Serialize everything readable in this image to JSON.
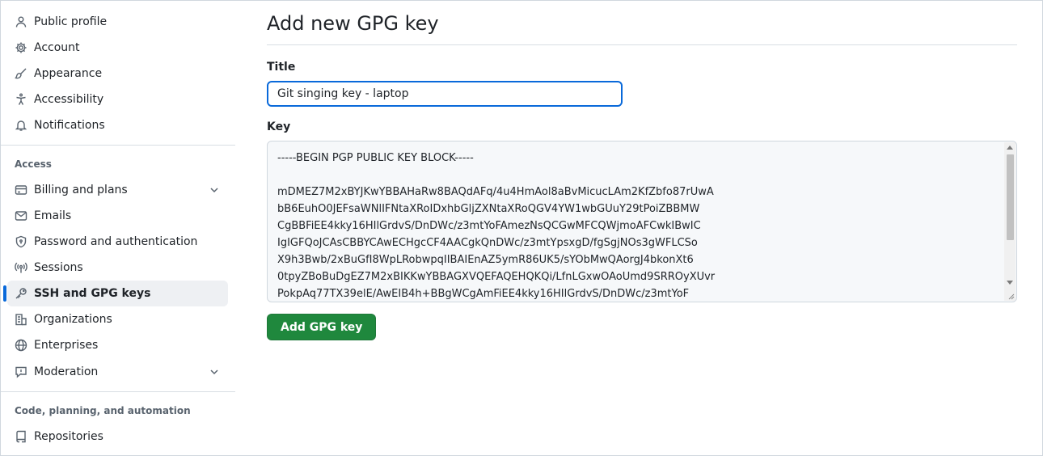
{
  "sidebar": {
    "items_top": [
      {
        "label": "Public profile",
        "icon": "person-icon"
      },
      {
        "label": "Account",
        "icon": "gear-icon"
      },
      {
        "label": "Appearance",
        "icon": "paintbrush-icon"
      },
      {
        "label": "Accessibility",
        "icon": "accessibility-icon"
      },
      {
        "label": "Notifications",
        "icon": "bell-icon"
      }
    ],
    "access_heading": "Access",
    "access_items": [
      {
        "label": "Billing and plans",
        "icon": "credit-card-icon",
        "expandable": true
      },
      {
        "label": "Emails",
        "icon": "mail-icon"
      },
      {
        "label": "Password and authentication",
        "icon": "shield-lock-icon"
      },
      {
        "label": "Sessions",
        "icon": "broadcast-icon"
      },
      {
        "label": "SSH and GPG keys",
        "icon": "key-icon",
        "active": true
      },
      {
        "label": "Organizations",
        "icon": "organization-icon"
      },
      {
        "label": "Enterprises",
        "icon": "globe-icon"
      },
      {
        "label": "Moderation",
        "icon": "report-icon",
        "expandable": true
      }
    ],
    "code_heading": "Code, planning, and automation",
    "code_items": [
      {
        "label": "Repositories",
        "icon": "repo-icon"
      }
    ]
  },
  "main": {
    "title": "Add new GPG key",
    "title_label": "Title",
    "title_value": "Git singing key - laptop",
    "key_label": "Key",
    "key_lines": [
      "-----BEGIN PGP PUBLIC KEY BLOCK-----",
      "",
      "mDMEZ7M2xBYJKwYBBAHaRw8BAQdAFq/4u4HmAol8aBvMicucLAm2KfZbfo87rUwA",
      "bB6EuhO0JEFsaWNlIFNtaXRoIDxhbGljZXNtaXRoQGV4YW1wbGUuY29tPoiZBBMW",
      "CgBBFiEE4kky16HIlGrdvS/DnDWc/z3mtYoFAmezNsQCGwMFCQWjmoAFCwkIBwIC",
      "IgIGFQoJCAsCBBYCAwECHgcCF4AACgkQnDWc/z3mtYpsxgD/fgSgjNOs3gWFLCSo",
      "X9h3Bwb/2xBuGfI8WpLRobwpqIIBAIEnAZ5ymR86UK5/sYObMwQAorgJ4bkonXt6",
      "0tpyZBoBuDgEZ7M2xBIKKwYBBAGXVQEFAQEHQKQi/LfnLGxwOAoUmd9SRROyXUvr",
      "PokpAq77TX39elE/AwEIB4h+BBgWCgAmFiEE4kky16HIlGrdvS/DnDWc/z3mtYoF"
    ],
    "submit_label": "Add GPG key"
  },
  "colors": {
    "accent": "#0969da",
    "primary_button": "#1f883d",
    "active_bg": "#eef0f3",
    "border": "#d0d7de"
  }
}
